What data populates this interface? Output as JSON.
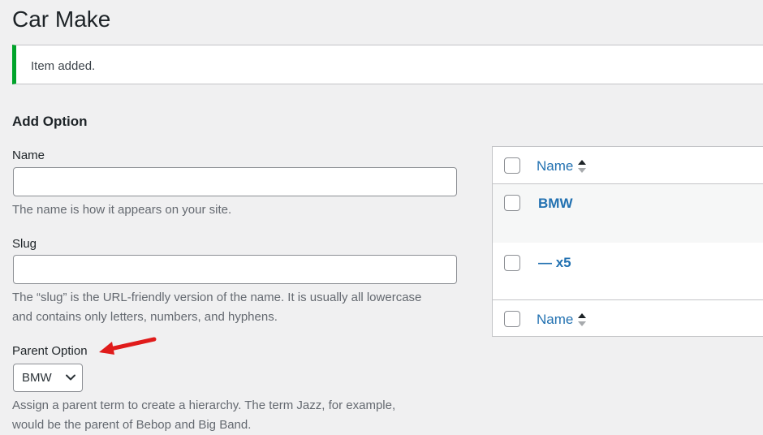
{
  "page": {
    "title": "Car Make"
  },
  "notice": {
    "message": "Item added."
  },
  "form": {
    "heading": "Add Option",
    "name": {
      "label": "Name",
      "value": "",
      "description": "The name is how it appears on your site."
    },
    "slug": {
      "label": "Slug",
      "value": "",
      "description_line1": "The “slug” is the URL-friendly version of the name. It is usually all lowercase",
      "description_line2": "and contains only letters, numbers, and hyphens."
    },
    "parent": {
      "label": "Parent Option",
      "selected": "BMW",
      "description_line1": "Assign a parent term to create a hierarchy. The term Jazz, for example,",
      "description_line2": "would be the parent of Bebop and Big Band."
    }
  },
  "table": {
    "column_name": "Name",
    "footer_name": "Name",
    "rows": [
      {
        "name": "BMW"
      },
      {
        "name": "— x5"
      }
    ]
  },
  "colors": {
    "accent": "#2271b1",
    "success": "#00a32a",
    "annotation_arrow": "#e01b1b"
  },
  "icons": {
    "select": "chevron-down-icon",
    "sort": "sort-icon",
    "annotation": "red-arrow-icon"
  }
}
